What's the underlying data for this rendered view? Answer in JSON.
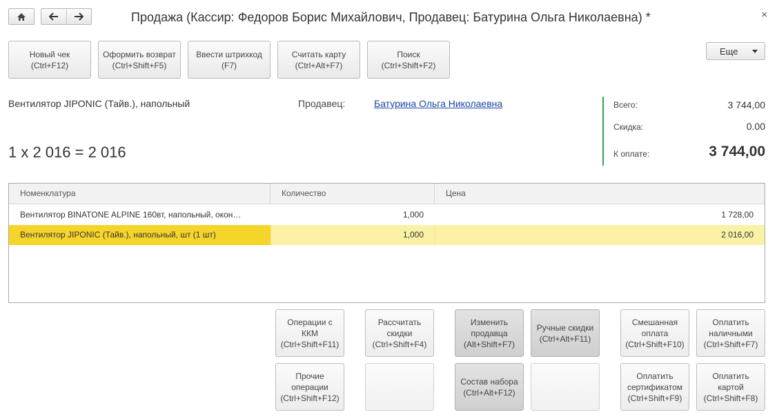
{
  "window": {
    "title": "Продажа (Кассир: Федоров Борис Михайлович, Продавец: Батурина Ольга Николаевна) *",
    "close_glyph": "×"
  },
  "nav": {
    "home_icon": "home-icon",
    "back_icon": "arrow-left-icon",
    "forward_icon": "arrow-right-icon"
  },
  "toolbar": {
    "buttons": [
      {
        "line1": "Новый чек",
        "line2": "(Ctrl+F12)"
      },
      {
        "line1": "Оформить возврат",
        "line2": "(Ctrl+Shift+F5)"
      },
      {
        "line1": "Ввести штрихкод",
        "line2": "(F7)"
      },
      {
        "line1": "Считать карту",
        "line2": "(Ctrl+Alt+F7)"
      },
      {
        "line1": "Поиск",
        "line2": "(Ctrl+Shift+F2)"
      }
    ],
    "more_label": "Еще"
  },
  "current": {
    "item_name": "Вентилятор JIPONIC (Тайв.), напольный",
    "seller_label": "Продавец:",
    "seller_name": "Батурина Ольга Николаевна",
    "calc": "1 x 2 016 = 2 016"
  },
  "totals": {
    "total_label": "Всего:",
    "total_value": "3 744,00",
    "discount_label": "Скидка:",
    "discount_value": "0.00",
    "pay_label": "К оплате:",
    "pay_value": "3 744,00",
    "accent_color": "#3aa050"
  },
  "table": {
    "columns": [
      "Номенклатура",
      "Количество",
      "Цена"
    ],
    "rows": [
      {
        "name": "Вентилятор BINATONE ALPINE 160вт, напольный, окон…",
        "qty": "1,000",
        "price": "1 728,00",
        "selected": false
      },
      {
        "name": "Вентилятор JIPONIC (Тайв.), напольный, шт (1 шт)",
        "qty": "1,000",
        "price": "2 016,00",
        "selected": true
      }
    ]
  },
  "actions": {
    "kkm": {
      "l1": "Операции с",
      "l2": "ККМ",
      "l3": "(Ctrl+Shift+F11)"
    },
    "recalc": {
      "l1": "Рассчитать",
      "l2": "скидки",
      "l3": "(Ctrl+Shift+F4)"
    },
    "change_seller": {
      "l1": "Изменить",
      "l2": "продавца",
      "l3": "(Alt+Shift+F7)"
    },
    "manual_discounts": {
      "l1": "Ручные скидки",
      "l2": "(Ctrl+Alt+F11)"
    },
    "mixed_payment": {
      "l1": "Смешанная",
      "l2": "оплата",
      "l3": "(Ctrl+Shift+F10)"
    },
    "pay_cash": {
      "l1": "Оплатить",
      "l2": "наличными",
      "l3": "(Ctrl+Shift+F7)"
    },
    "other_ops": {
      "l1": "Прочие",
      "l2": "операции",
      "l3": "(Ctrl+Shift+F12)"
    },
    "kit": {
      "l1": "Состав набора",
      "l2": "(Ctrl+Alt+F12)"
    },
    "pay_certificate": {
      "l1": "Оплатить",
      "l2": "сертификатом",
      "l3": "(Ctrl+Shift+F9)"
    },
    "pay_card": {
      "l1": "Оплатить",
      "l2": "картой",
      "l3": "(Ctrl+Shift+F8)"
    }
  }
}
